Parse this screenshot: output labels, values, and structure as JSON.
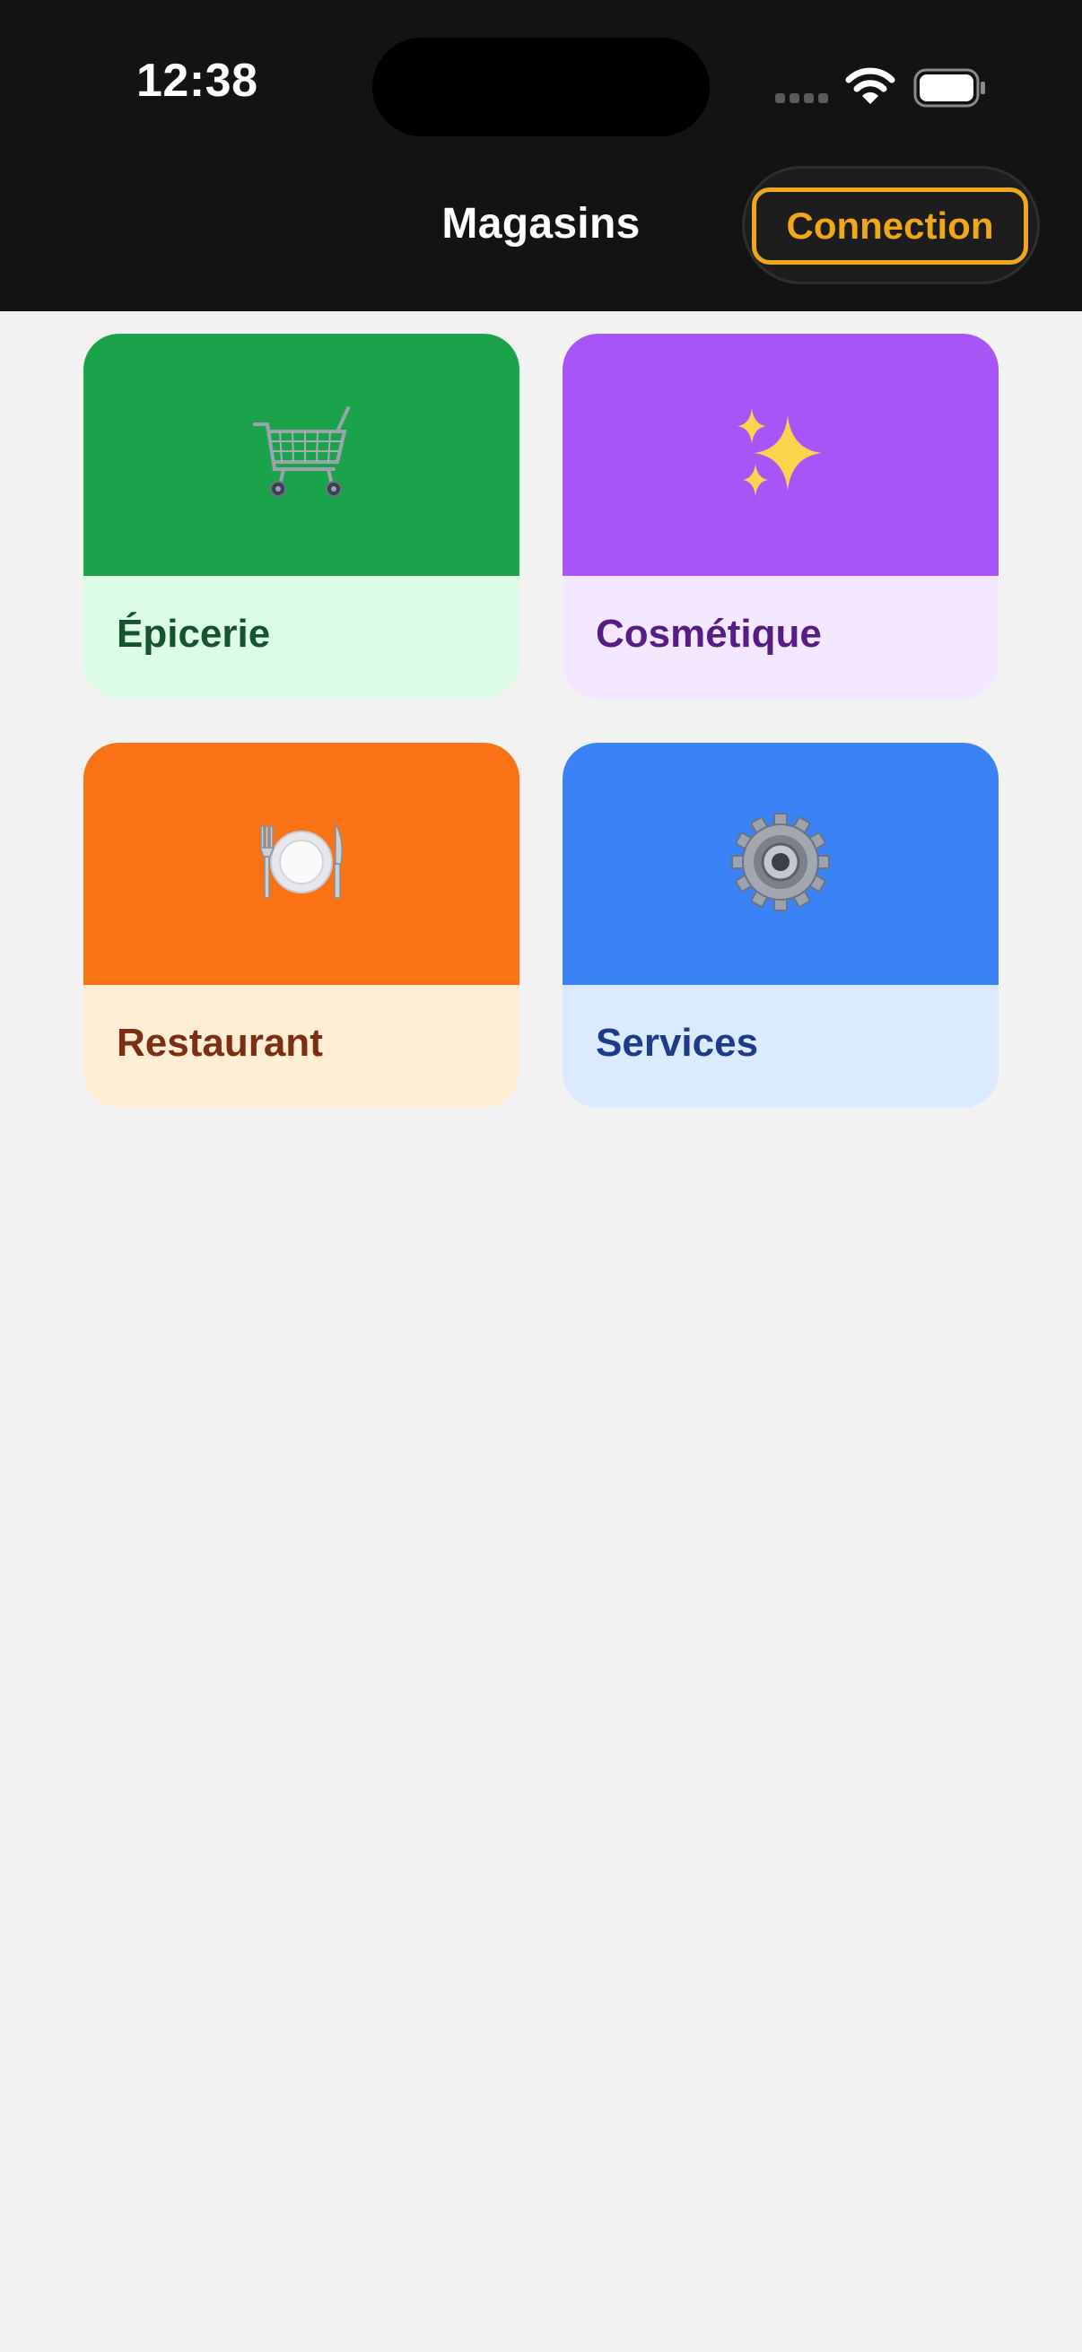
{
  "status_bar": {
    "time": "12:38"
  },
  "nav": {
    "title": "Magasins",
    "connection_label": "Connection"
  },
  "categories": [
    {
      "label": "Épicerie",
      "icon": "shopping-cart-icon",
      "accent": "#1aa34a",
      "tint": "#dcfce7",
      "text_color": "#14532d"
    },
    {
      "label": "Cosmétique",
      "icon": "sparkles-icon",
      "accent": "#a855f7",
      "tint": "#f3e8ff",
      "text_color": "#581c87"
    },
    {
      "label": "Restaurant",
      "icon": "fork-knife-plate-icon",
      "accent": "#f97316",
      "tint": "#ffedd5",
      "text_color": "#7c2d12"
    },
    {
      "label": "Services",
      "icon": "gear-icon",
      "accent": "#3b82f6",
      "tint": "#dbeafe",
      "text_color": "#1e3a8a"
    }
  ]
}
